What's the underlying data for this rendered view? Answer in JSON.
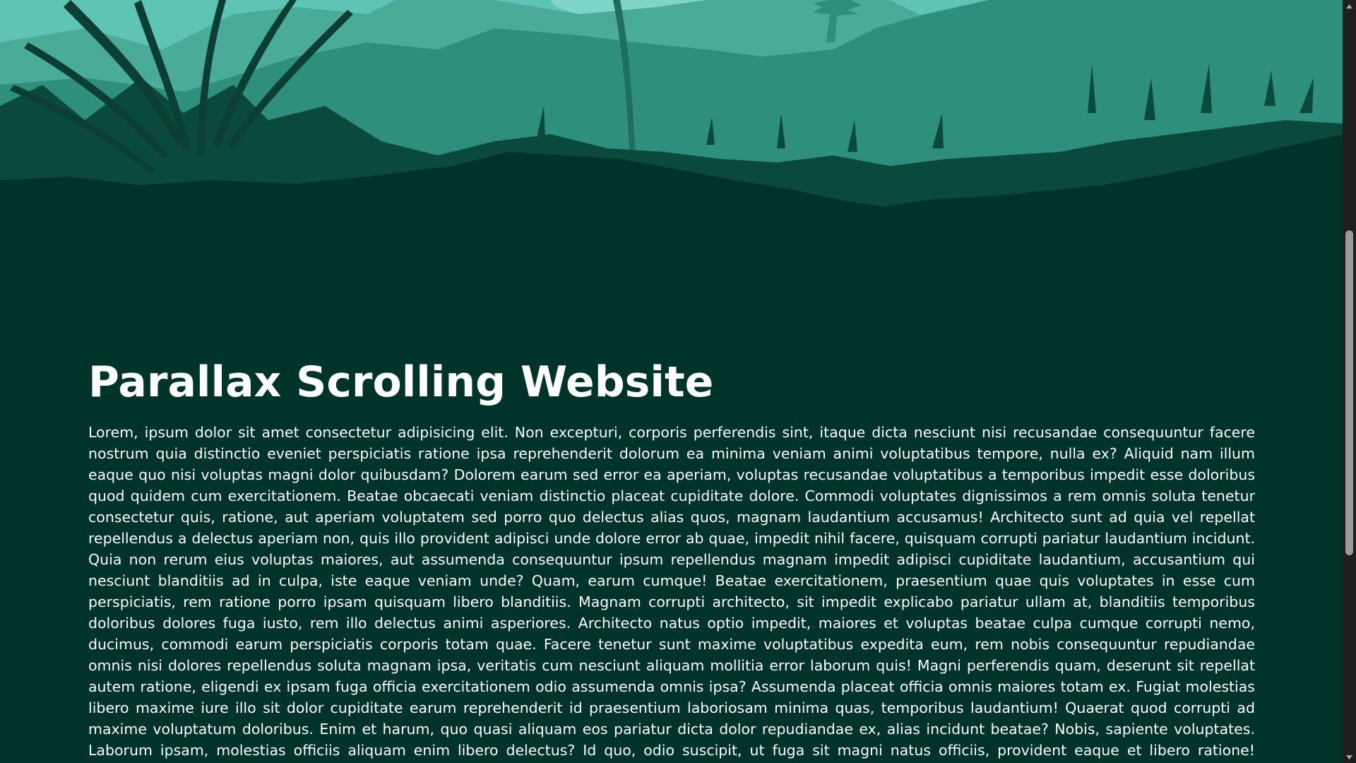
{
  "page": {
    "title": "Parallax Scrolling Website",
    "paragraph": "Lorem, ipsum dolor sit amet consectetur adipisicing elit. Non excepturi, corporis perferendis sint, itaque dicta nesciunt nisi recusandae consequuntur facere nostrum quia distinctio eveniet perspiciatis ratione ipsa reprehenderit dolorum ea minima veniam animi voluptatibus tempore, nulla ex? Aliquid nam illum eaque quo nisi voluptas magni dolor quibusdam? Dolorem earum sed error ea aperiam, voluptas recusandae voluptatibus a temporibus impedit esse doloribus quod quidem cum exercitationem. Beatae obcaecati veniam distinctio placeat cupiditate dolore. Commodi voluptates dignissimos a rem omnis soluta tenetur consectetur quis, ratione, aut aperiam voluptatem sed porro quo delectus alias quos, magnam laudantium accusamus! Architecto sunt ad quia vel repellat repellendus a delectus aperiam non, quis illo provident adipisci unde dolore error ab quae, impedit nihil facere, quisquam corrupti pariatur laudantium incidunt. Quia non rerum eius voluptas maiores, aut assumenda consequuntur ipsum repellendus magnam impedit adipisci cupiditate laudantium, accusantium qui nesciunt blanditiis ad in culpa, iste eaque veniam unde? Quam, earum cumque! Beatae exercitationem, praesentium quae quis voluptates in esse cum perspiciatis, rem ratione porro ipsam quisquam libero blanditiis. Magnam corrupti architecto, sit impedit explicabo pariatur ullam at, blanditiis temporibus doloribus dolores fuga iusto, rem illo delectus animi asperiores. Architecto natus optio impedit, maiores et voluptas beatae culpa cumque corrupti nemo, ducimus, commodi earum perspiciatis corporis totam quae. Facere tenetur sunt maxime voluptatibus expedita eum, rem nobis consequuntur repudiandae omnis nisi dolores repellendus soluta magnam ipsa, veritatis cum nesciunt aliquam mollitia error laborum quis! Magni perferendis quam, deserunt sit repellat autem ratione, eligendi ex ipsam fuga officia exercitationem odio assumenda omnis ipsa? Assumenda placeat officia omnis maiores totam ex. Fugiat molestias libero maxime iure illo sit dolor cupiditate earum reprehenderit id praesentium laboriosam minima quas, temporibus laudantium! Quaerat quod corrupti ad maxime voluptatum doloribus. Enim et harum, quo quasi aliquam eos pariatur dicta dolor repudiandae ex, alias incidunt beatae? Nobis, sapiente voluptates. Laborum ipsam, molestias officiis aliquam enim libero delectus? Id quo, odio suscipit, ut fuga sit magni natus officiis, provident eaque et libero ratione! Quibusdam illum saepe hic modi labore nesciunt dolore temporibus? Quibusdam, quis nisi. Fugit debitis omnis,"
  },
  "colors": {
    "background": "#003329",
    "sky": "#5fc4b4",
    "far_hills": "#4aab98",
    "mid_hills": "#2e8f7c",
    "near_foliage": "#0a4a3c",
    "foreground": "#003329",
    "text": "#ffffff",
    "scrollbar_track": "#1e1e1e",
    "scrollbar_thumb": "#9a9a9a"
  },
  "scrollbar": {
    "up_icon": "triangle-up-icon",
    "down_icon": "triangle-down-icon"
  }
}
